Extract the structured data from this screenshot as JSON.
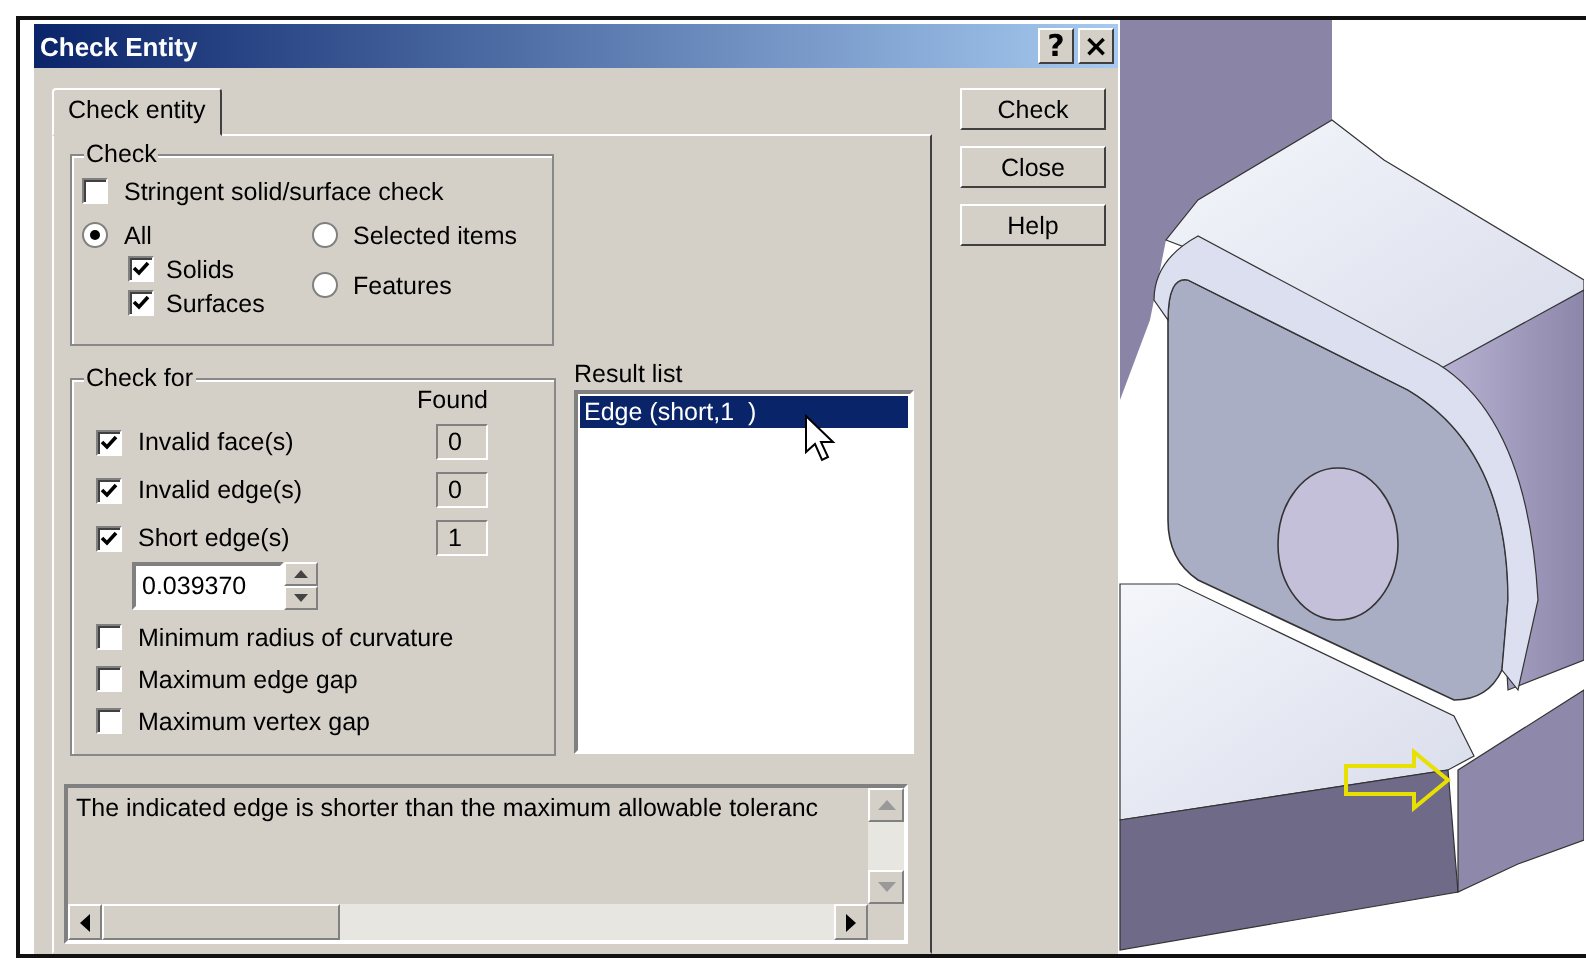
{
  "window": {
    "title": "Check Entity",
    "title_buttons": [
      "?",
      "×"
    ]
  },
  "tabs": [
    {
      "label": "Check entity",
      "selected": true
    }
  ],
  "buttons": [
    "Check",
    "Close",
    "Help"
  ],
  "check_group": {
    "title": "Check",
    "stringent": {
      "label": "Stringent solid/surface check",
      "checked": false
    },
    "scope": [
      {
        "label": "All",
        "selected": true,
        "children": [
          {
            "label": "Solids",
            "checked": true
          },
          {
            "label": "Surfaces",
            "checked": true
          }
        ]
      },
      {
        "label": "Selected items",
        "selected": false
      },
      {
        "label": "Features",
        "selected": false
      }
    ]
  },
  "check_for": {
    "title": "Check for",
    "found_header": "Found",
    "items": [
      {
        "label": "Invalid face(s)",
        "checked": true,
        "found": "0"
      },
      {
        "label": "Invalid edge(s)",
        "checked": true,
        "found": "0"
      },
      {
        "label": "Short edge(s)",
        "checked": true,
        "found": "1"
      }
    ],
    "tolerance": "0.039370",
    "limits": [
      {
        "label": "Minimum radius of curvature",
        "checked": false
      },
      {
        "label": "Maximum edge gap",
        "checked": false
      },
      {
        "label": "Maximum vertex gap",
        "checked": false
      }
    ]
  },
  "result_list": {
    "label": "Result list",
    "items": [
      {
        "text": "Edge (short,1  )",
        "selected": true
      }
    ]
  },
  "message": "The indicated edge is shorter than the maximum allowable toleranc"
}
